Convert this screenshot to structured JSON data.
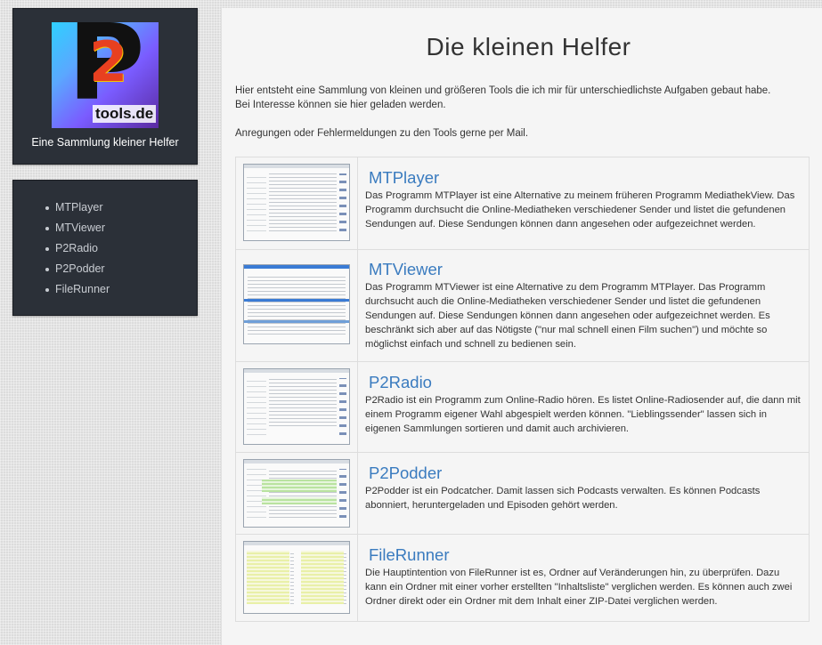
{
  "sidebar": {
    "logo_text": "tools.de",
    "logo_mark": "P2",
    "caption": "Eine Sammlung kleiner Helfer",
    "nav": [
      "MTPlayer",
      "MTViewer",
      "P2Radio",
      "P2Podder",
      "FileRunner"
    ]
  },
  "main": {
    "title": "Die kleinen Helfer",
    "intro": "Hier entsteht eine Sammlung von kleinen und größeren Tools die ich mir für unterschiedlichste Aufgaben gebaut habe. Bei Interesse können sie hier geladen werden.",
    "intro2": "Anregungen oder Fehlermeldungen zu den Tools gerne per Mail.",
    "tools": [
      {
        "name": "MTPlayer",
        "desc": "Das Programm MTPlayer ist eine Alternative zu meinem früheren Programm MediathekView. Das Programm durchsucht die Online-Mediatheken verschiedener Sender und listet die gefundenen Sendungen auf. Diese Sendungen können dann angesehen oder aufgezeichnet werden."
      },
      {
        "name": "MTViewer",
        "desc": "Das Programm MTViewer ist eine Alternative zu dem Programm MTPlayer. Das Programm durchsucht auch die Online-Mediatheken verschiedener Sender und listet die gefundenen Sendungen auf. Diese Sendungen können dann angesehen oder aufgezeichnet werden. Es beschränkt sich aber auf das Nötigste (\"nur mal schnell einen Film suchen\") und möchte so möglichst einfach und schnell zu bedienen sein."
      },
      {
        "name": "P2Radio",
        "desc": "P2Radio ist ein Programm zum Online-Radio hören. Es listet Online-Radiosender auf, die dann mit einem Programm eigener Wahl abgespielt werden können. \"Lieblingssender\" lassen sich in eigenen Sammlungen sortieren und damit auch archivieren."
      },
      {
        "name": "P2Podder",
        "desc": "P2Podder ist ein Podcatcher. Damit lassen sich Podcasts verwalten. Es können Podcasts abonniert, heruntergeladen und Episoden gehört werden."
      },
      {
        "name": "FileRunner",
        "desc": "Die Hauptintention von FileRunner ist es, Ordner auf Veränderungen hin, zu überprüfen. Dazu kann ein Ordner mit einer vorher erstellten \"Inhaltsliste\" verglichen werden. Es können auch zwei Ordner direkt oder ein Ordner mit dem Inhalt einer ZIP-Datei verglichen werden."
      }
    ]
  }
}
